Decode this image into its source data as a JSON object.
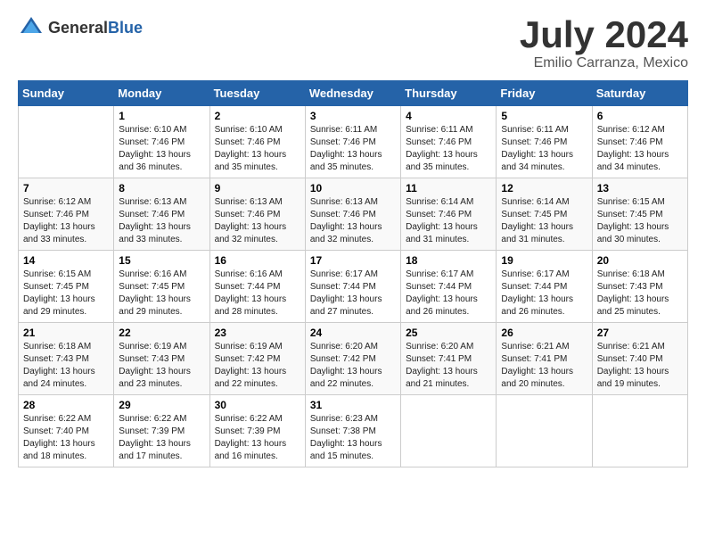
{
  "header": {
    "logo_general": "General",
    "logo_blue": "Blue",
    "title": "July 2024",
    "subtitle": "Emilio Carranza, Mexico"
  },
  "days_of_week": [
    "Sunday",
    "Monday",
    "Tuesday",
    "Wednesday",
    "Thursday",
    "Friday",
    "Saturday"
  ],
  "weeks": [
    [
      {
        "day": "",
        "sunrise": "",
        "sunset": "",
        "daylight": ""
      },
      {
        "day": "1",
        "sunrise": "Sunrise: 6:10 AM",
        "sunset": "Sunset: 7:46 PM",
        "daylight": "Daylight: 13 hours and 36 minutes."
      },
      {
        "day": "2",
        "sunrise": "Sunrise: 6:10 AM",
        "sunset": "Sunset: 7:46 PM",
        "daylight": "Daylight: 13 hours and 35 minutes."
      },
      {
        "day": "3",
        "sunrise": "Sunrise: 6:11 AM",
        "sunset": "Sunset: 7:46 PM",
        "daylight": "Daylight: 13 hours and 35 minutes."
      },
      {
        "day": "4",
        "sunrise": "Sunrise: 6:11 AM",
        "sunset": "Sunset: 7:46 PM",
        "daylight": "Daylight: 13 hours and 35 minutes."
      },
      {
        "day": "5",
        "sunrise": "Sunrise: 6:11 AM",
        "sunset": "Sunset: 7:46 PM",
        "daylight": "Daylight: 13 hours and 34 minutes."
      },
      {
        "day": "6",
        "sunrise": "Sunrise: 6:12 AM",
        "sunset": "Sunset: 7:46 PM",
        "daylight": "Daylight: 13 hours and 34 minutes."
      }
    ],
    [
      {
        "day": "7",
        "sunrise": "Sunrise: 6:12 AM",
        "sunset": "Sunset: 7:46 PM",
        "daylight": "Daylight: 13 hours and 33 minutes."
      },
      {
        "day": "8",
        "sunrise": "Sunrise: 6:13 AM",
        "sunset": "Sunset: 7:46 PM",
        "daylight": "Daylight: 13 hours and 33 minutes."
      },
      {
        "day": "9",
        "sunrise": "Sunrise: 6:13 AM",
        "sunset": "Sunset: 7:46 PM",
        "daylight": "Daylight: 13 hours and 32 minutes."
      },
      {
        "day": "10",
        "sunrise": "Sunrise: 6:13 AM",
        "sunset": "Sunset: 7:46 PM",
        "daylight": "Daylight: 13 hours and 32 minutes."
      },
      {
        "day": "11",
        "sunrise": "Sunrise: 6:14 AM",
        "sunset": "Sunset: 7:46 PM",
        "daylight": "Daylight: 13 hours and 31 minutes."
      },
      {
        "day": "12",
        "sunrise": "Sunrise: 6:14 AM",
        "sunset": "Sunset: 7:45 PM",
        "daylight": "Daylight: 13 hours and 31 minutes."
      },
      {
        "day": "13",
        "sunrise": "Sunrise: 6:15 AM",
        "sunset": "Sunset: 7:45 PM",
        "daylight": "Daylight: 13 hours and 30 minutes."
      }
    ],
    [
      {
        "day": "14",
        "sunrise": "Sunrise: 6:15 AM",
        "sunset": "Sunset: 7:45 PM",
        "daylight": "Daylight: 13 hours and 29 minutes."
      },
      {
        "day": "15",
        "sunrise": "Sunrise: 6:16 AM",
        "sunset": "Sunset: 7:45 PM",
        "daylight": "Daylight: 13 hours and 29 minutes."
      },
      {
        "day": "16",
        "sunrise": "Sunrise: 6:16 AM",
        "sunset": "Sunset: 7:44 PM",
        "daylight": "Daylight: 13 hours and 28 minutes."
      },
      {
        "day": "17",
        "sunrise": "Sunrise: 6:17 AM",
        "sunset": "Sunset: 7:44 PM",
        "daylight": "Daylight: 13 hours and 27 minutes."
      },
      {
        "day": "18",
        "sunrise": "Sunrise: 6:17 AM",
        "sunset": "Sunset: 7:44 PM",
        "daylight": "Daylight: 13 hours and 26 minutes."
      },
      {
        "day": "19",
        "sunrise": "Sunrise: 6:17 AM",
        "sunset": "Sunset: 7:44 PM",
        "daylight": "Daylight: 13 hours and 26 minutes."
      },
      {
        "day": "20",
        "sunrise": "Sunrise: 6:18 AM",
        "sunset": "Sunset: 7:43 PM",
        "daylight": "Daylight: 13 hours and 25 minutes."
      }
    ],
    [
      {
        "day": "21",
        "sunrise": "Sunrise: 6:18 AM",
        "sunset": "Sunset: 7:43 PM",
        "daylight": "Daylight: 13 hours and 24 minutes."
      },
      {
        "day": "22",
        "sunrise": "Sunrise: 6:19 AM",
        "sunset": "Sunset: 7:43 PM",
        "daylight": "Daylight: 13 hours and 23 minutes."
      },
      {
        "day": "23",
        "sunrise": "Sunrise: 6:19 AM",
        "sunset": "Sunset: 7:42 PM",
        "daylight": "Daylight: 13 hours and 22 minutes."
      },
      {
        "day": "24",
        "sunrise": "Sunrise: 6:20 AM",
        "sunset": "Sunset: 7:42 PM",
        "daylight": "Daylight: 13 hours and 22 minutes."
      },
      {
        "day": "25",
        "sunrise": "Sunrise: 6:20 AM",
        "sunset": "Sunset: 7:41 PM",
        "daylight": "Daylight: 13 hours and 21 minutes."
      },
      {
        "day": "26",
        "sunrise": "Sunrise: 6:21 AM",
        "sunset": "Sunset: 7:41 PM",
        "daylight": "Daylight: 13 hours and 20 minutes."
      },
      {
        "day": "27",
        "sunrise": "Sunrise: 6:21 AM",
        "sunset": "Sunset: 7:40 PM",
        "daylight": "Daylight: 13 hours and 19 minutes."
      }
    ],
    [
      {
        "day": "28",
        "sunrise": "Sunrise: 6:22 AM",
        "sunset": "Sunset: 7:40 PM",
        "daylight": "Daylight: 13 hours and 18 minutes."
      },
      {
        "day": "29",
        "sunrise": "Sunrise: 6:22 AM",
        "sunset": "Sunset: 7:39 PM",
        "daylight": "Daylight: 13 hours and 17 minutes."
      },
      {
        "day": "30",
        "sunrise": "Sunrise: 6:22 AM",
        "sunset": "Sunset: 7:39 PM",
        "daylight": "Daylight: 13 hours and 16 minutes."
      },
      {
        "day": "31",
        "sunrise": "Sunrise: 6:23 AM",
        "sunset": "Sunset: 7:38 PM",
        "daylight": "Daylight: 13 hours and 15 minutes."
      },
      {
        "day": "",
        "sunrise": "",
        "sunset": "",
        "daylight": ""
      },
      {
        "day": "",
        "sunrise": "",
        "sunset": "",
        "daylight": ""
      },
      {
        "day": "",
        "sunrise": "",
        "sunset": "",
        "daylight": ""
      }
    ]
  ]
}
